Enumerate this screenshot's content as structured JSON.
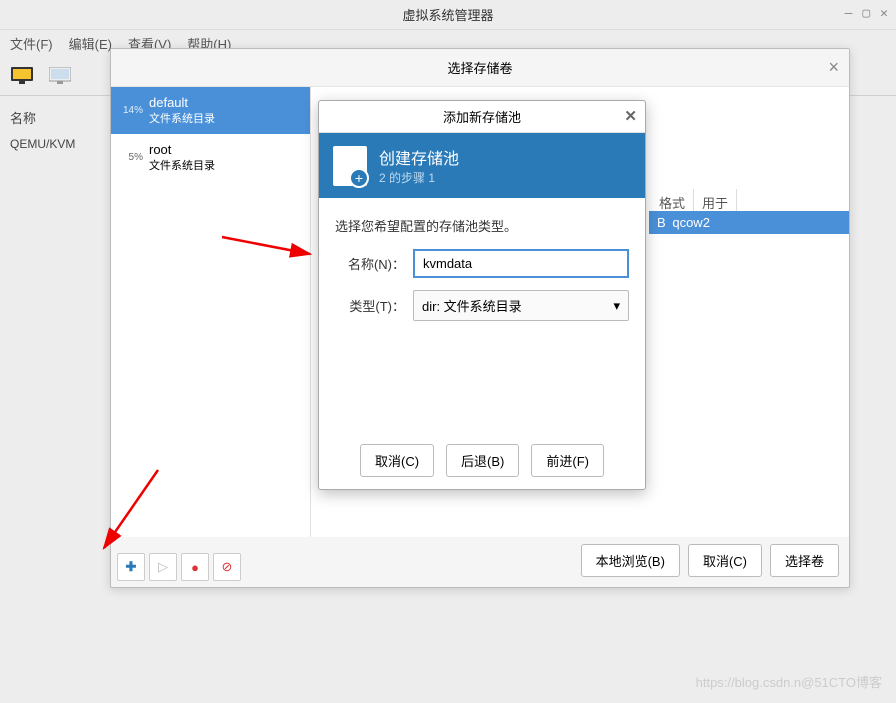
{
  "main": {
    "title": "虚拟系统管理器",
    "menu": {
      "file": "文件(F)",
      "edit": "编辑(E)",
      "view": "查看(V)",
      "help": "帮助(H)"
    },
    "side": {
      "name_header": "名称",
      "connection": "QEMU/KVM"
    }
  },
  "dialog1": {
    "title": "选择存储卷",
    "pools": [
      {
        "pct": "14%",
        "name": "default",
        "sub": "文件系统目录",
        "selected": true
      },
      {
        "pct": "5%",
        "name": "root",
        "sub": "文件系统目录",
        "selected": false
      }
    ],
    "vol_headers": {
      "format": "格式",
      "used_by": "用于"
    },
    "vol_row": {
      "size": "B",
      "format": "qcow2"
    },
    "buttons": {
      "browse": "本地浏览(B)",
      "cancel": "取消(C)",
      "select": "选择卷"
    }
  },
  "dialog2": {
    "title": "添加新存储池",
    "header": {
      "title": "创建存储池",
      "step": "2 的步骤 1"
    },
    "desc": "选择您希望配置的存储池类型。",
    "name_label": "名称(N)：",
    "name_value": "kvmdata",
    "type_label": "类型(T)：",
    "type_value": "dir: 文件系统目录",
    "buttons": {
      "cancel": "取消(C)",
      "back": "后退(B)",
      "forward": "前进(F)"
    }
  },
  "watermark": "https://blog.csdn.n@51CTO博客"
}
